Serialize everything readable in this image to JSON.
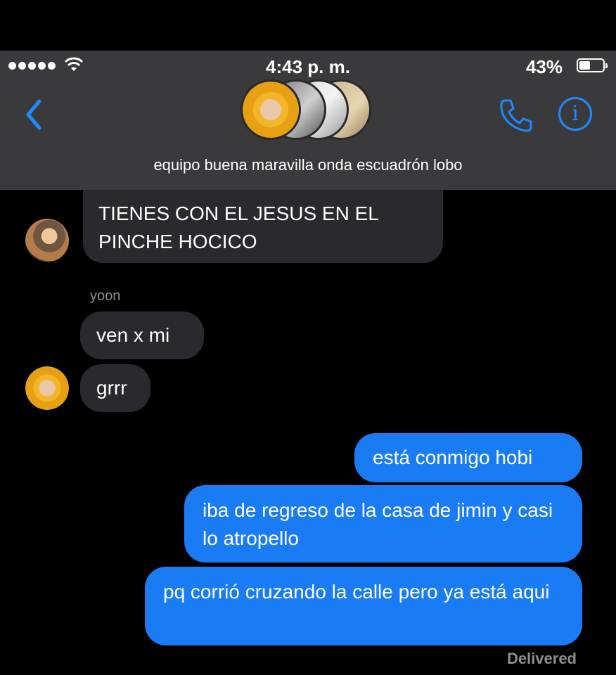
{
  "status_bar": {
    "time": "4:43 p. m.",
    "battery": "43%"
  },
  "header": {
    "group_name": "equipo buena maravilla onda escuadrón lobo"
  },
  "messages": [
    {
      "direction": "incoming",
      "text": "TIENES CON EL JESUS EN EL PINCHE HOCICO"
    },
    {
      "direction": "incoming",
      "sender": "yoon",
      "text": "ven x mi"
    },
    {
      "direction": "incoming",
      "text": "grrr"
    },
    {
      "direction": "outgoing",
      "text": "está conmigo hobi"
    },
    {
      "direction": "outgoing",
      "text": "iba de regreso de la casa de jimin y casi lo atropello"
    },
    {
      "direction": "outgoing",
      "text": "pq corrió cruzando la calle pero ya está aqui"
    }
  ],
  "delivery_status": "Delivered",
  "icons": [
    "signal-dots-icon",
    "wifi-icon",
    "battery-icon",
    "back-chevron-icon",
    "phone-icon",
    "info-icon"
  ],
  "colors": {
    "accent": "#1a8cff",
    "outgoing_bubble": "#1a7cf5",
    "incoming_bubble": "#2a292e",
    "header_bg": "#3a3a3c"
  }
}
